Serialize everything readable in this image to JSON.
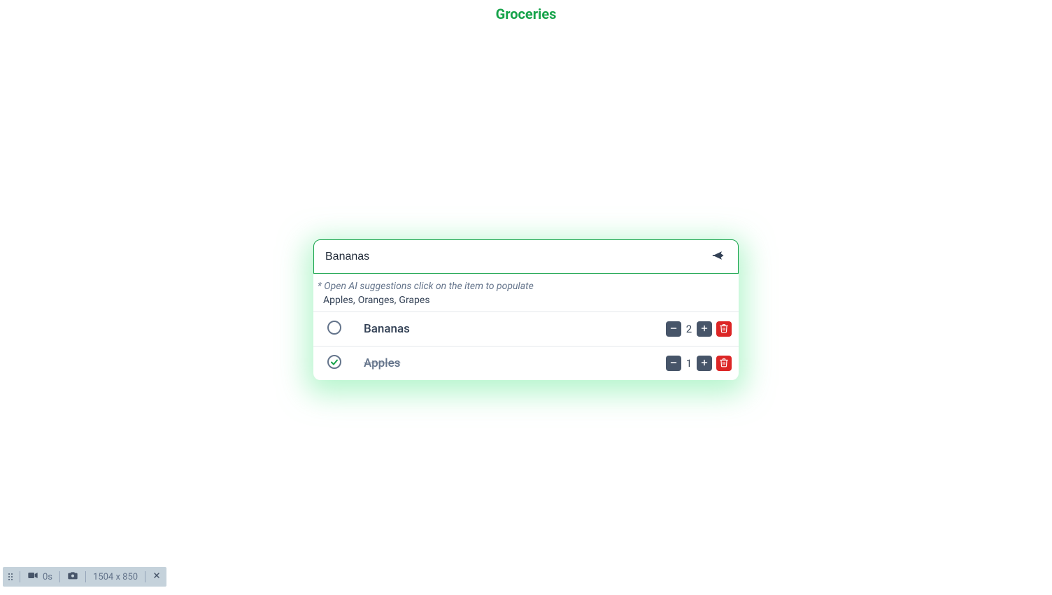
{
  "header": {
    "title": "Groceries"
  },
  "input": {
    "value": "Bananas"
  },
  "suggestions": {
    "hint": "* Open AI suggestions click on the item to populate",
    "items": [
      "Apples",
      "Oranges",
      "Grapes"
    ]
  },
  "list": {
    "items": [
      {
        "name": "Bananas",
        "quantity": 2,
        "done": false
      },
      {
        "name": "Apples",
        "quantity": 1,
        "done": true
      }
    ]
  },
  "toolbar": {
    "time": "0s",
    "dimensions": "1504 x 850"
  }
}
